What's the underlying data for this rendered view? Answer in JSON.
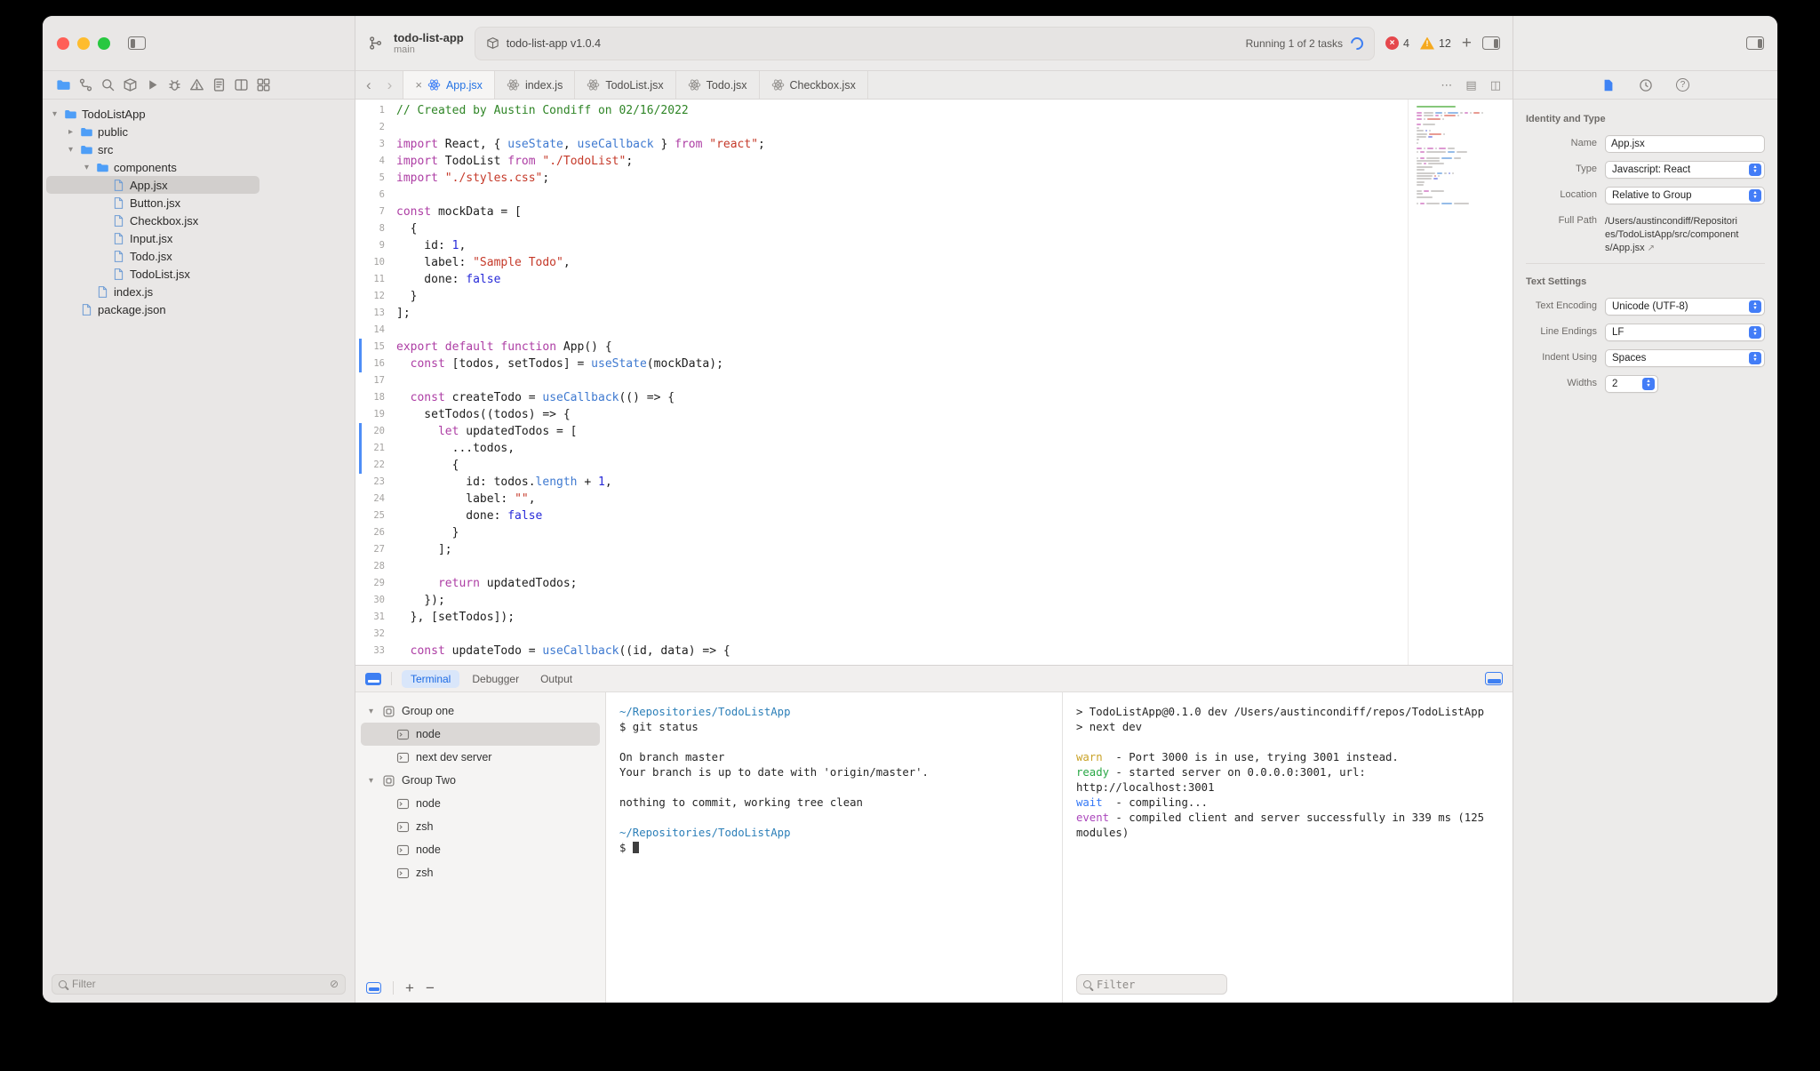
{
  "icons": {
    "back": "‹",
    "forward": "›",
    "close": "×",
    "ellipsis": "⋯",
    "chevron_down": "▾",
    "chevron_right": "▸",
    "plus": "+",
    "minus": "−",
    "filter_clear": "⊘",
    "path_arrow": "↗",
    "warning_mark": "!",
    "error_mark": "×",
    "split_editor": "◫",
    "snippets": "▤",
    "help_mark": "?",
    "stepper_up": "▲",
    "stepper_down": "▼"
  },
  "window": {
    "project": "todo-list-app",
    "branch": "main"
  },
  "toolbar": {
    "scheme_label": "todo-list-app v1.0.4",
    "status_label": "Running 1 of 2 tasks",
    "error_count": "4",
    "warning_count": "12"
  },
  "sidebar": {
    "nav_icons": [
      "project-navigator",
      "source-control",
      "find",
      "packages",
      "run-tasks",
      "debug",
      "issues",
      "reports",
      "editors",
      "overview"
    ],
    "filter_placeholder": "Filter",
    "tree": [
      {
        "label": "TodoListApp",
        "depth": 0,
        "type": "folder",
        "expanded": true
      },
      {
        "label": "public",
        "depth": 1,
        "type": "folder",
        "expanded": false
      },
      {
        "label": "src",
        "depth": 1,
        "type": "folder",
        "expanded": true
      },
      {
        "label": "components",
        "depth": 2,
        "type": "folder",
        "expanded": true
      },
      {
        "label": "App.jsx",
        "depth": 3,
        "type": "file",
        "selected": true
      },
      {
        "label": "Button.jsx",
        "depth": 3,
        "type": "file"
      },
      {
        "label": "Checkbox.jsx",
        "depth": 3,
        "type": "file"
      },
      {
        "label": "Input.jsx",
        "depth": 3,
        "type": "file"
      },
      {
        "label": "Todo.jsx",
        "depth": 3,
        "type": "file"
      },
      {
        "label": "TodoList.jsx",
        "depth": 3,
        "type": "file"
      },
      {
        "label": "index.js",
        "depth": 2,
        "type": "file"
      },
      {
        "label": "package.json",
        "depth": 1,
        "type": "file"
      }
    ]
  },
  "tabs": [
    {
      "label": "App.jsx",
      "active": true
    },
    {
      "label": "index.js"
    },
    {
      "label": "TodoList.jsx"
    },
    {
      "label": "Todo.jsx"
    },
    {
      "label": "Checkbox.jsx"
    }
  ],
  "editor": {
    "changed": [
      15,
      16,
      20,
      21,
      22
    ],
    "lines": [
      [
        [
          "// Created by Austin Condiff on 02/16/2022",
          "cm"
        ]
      ],
      [],
      [
        [
          "import",
          "kw"
        ],
        [
          " React, { ",
          ""
        ],
        [
          "useState",
          "fn"
        ],
        [
          ", ",
          ""
        ],
        [
          "useCallback",
          "fn"
        ],
        [
          " } ",
          ""
        ],
        [
          "from",
          "kw"
        ],
        [
          " ",
          ""
        ],
        [
          "\"react\"",
          "str"
        ],
        [
          ";",
          ""
        ]
      ],
      [
        [
          "import",
          "kw"
        ],
        [
          " TodoList ",
          ""
        ],
        [
          "from",
          "kw"
        ],
        [
          " ",
          ""
        ],
        [
          "\"./TodoList\"",
          "str"
        ],
        [
          ";",
          ""
        ]
      ],
      [
        [
          "import",
          "kw"
        ],
        [
          " ",
          ""
        ],
        [
          "\"./styles.css\"",
          "str"
        ],
        [
          ";",
          ""
        ]
      ],
      [],
      [
        [
          "const",
          "kw"
        ],
        [
          " mockData = [",
          ""
        ]
      ],
      [
        [
          "  {",
          ""
        ]
      ],
      [
        [
          "    id: ",
          ""
        ],
        [
          "1",
          "num"
        ],
        [
          ",",
          ""
        ]
      ],
      [
        [
          "    label: ",
          ""
        ],
        [
          "\"Sample Todo\"",
          "str"
        ],
        [
          ",",
          ""
        ]
      ],
      [
        [
          "    done: ",
          ""
        ],
        [
          "false",
          "num"
        ]
      ],
      [
        [
          "  }",
          ""
        ]
      ],
      [
        [
          "];",
          ""
        ]
      ],
      [],
      [
        [
          "export",
          "kw"
        ],
        [
          " ",
          ""
        ],
        [
          "default",
          "kw"
        ],
        [
          " ",
          ""
        ],
        [
          "function",
          "kw"
        ],
        [
          " App() {",
          ""
        ]
      ],
      [
        [
          "  ",
          ""
        ],
        [
          "const",
          "kw"
        ],
        [
          " [todos, setTodos] = ",
          ""
        ],
        [
          "useState",
          "fn"
        ],
        [
          "(mockData);",
          ""
        ]
      ],
      [],
      [
        [
          "  ",
          ""
        ],
        [
          "const",
          "kw"
        ],
        [
          " createTodo = ",
          ""
        ],
        [
          "useCallback",
          "fn"
        ],
        [
          "(() => {",
          ""
        ]
      ],
      [
        [
          "    setTodos((todos) => {",
          ""
        ]
      ],
      [
        [
          "      ",
          ""
        ],
        [
          "let",
          "kw"
        ],
        [
          " updatedTodos = [",
          ""
        ]
      ],
      [
        [
          "        ...todos,",
          ""
        ]
      ],
      [
        [
          "        {",
          ""
        ]
      ],
      [
        [
          "          id: todos.",
          ""
        ],
        [
          "length",
          "fn"
        ],
        [
          " + ",
          ""
        ],
        [
          "1",
          "num"
        ],
        [
          ",",
          ""
        ]
      ],
      [
        [
          "          label: ",
          ""
        ],
        [
          "\"\"",
          "str"
        ],
        [
          ",",
          ""
        ]
      ],
      [
        [
          "          done: ",
          ""
        ],
        [
          "false",
          "num"
        ]
      ],
      [
        [
          "        }",
          ""
        ]
      ],
      [
        [
          "      ];",
          ""
        ]
      ],
      [],
      [
        [
          "      ",
          ""
        ],
        [
          "return",
          "kw"
        ],
        [
          " updatedTodos;",
          ""
        ]
      ],
      [
        [
          "    });",
          ""
        ]
      ],
      [
        [
          "  }, [setTodos]);",
          ""
        ]
      ],
      [],
      [
        [
          "  ",
          ""
        ],
        [
          "const",
          "kw"
        ],
        [
          " updateTodo = ",
          ""
        ],
        [
          "useCallback",
          "fn"
        ],
        [
          "((id, data) => {",
          ""
        ]
      ]
    ]
  },
  "inspector": {
    "icon_names": [
      "file-inspector",
      "history-inspector",
      "quick-help-inspector"
    ],
    "identity_title": "Identity and Type",
    "fields": {
      "name": {
        "label": "Name",
        "value": "App.jsx"
      },
      "type": {
        "label": "Type",
        "value": "Javascript: React"
      },
      "location": {
        "label": "Location",
        "value": "Relative to Group"
      },
      "full_path": {
        "label": "Full Path",
        "value": "/Users/austincondiff/Repositories/TodoListApp/src/components/App.jsx"
      }
    },
    "text_settings_title": "Text Settings",
    "settings": {
      "encoding": {
        "label": "Text Encoding",
        "value": "Unicode (UTF-8)"
      },
      "line_endings": {
        "label": "Line Endings",
        "value": "LF"
      },
      "indent": {
        "label": "Indent Using",
        "value": "Spaces"
      },
      "widths": {
        "label": "Widths",
        "value": "2"
      }
    }
  },
  "panel": {
    "tabs": [
      {
        "label": "Terminal",
        "active": true
      },
      {
        "label": "Debugger"
      },
      {
        "label": "Output"
      }
    ],
    "filter_placeholder": "Filter",
    "groups": [
      {
        "label": "Group one",
        "type": "group",
        "depth": 0,
        "expanded": true
      },
      {
        "label": "node",
        "type": "terminal",
        "depth": 1,
        "selected": true
      },
      {
        "label": "next dev server",
        "type": "terminal",
        "depth": 1
      },
      {
        "label": "Group Two",
        "type": "group",
        "depth": 0,
        "expanded": true
      },
      {
        "label": "node",
        "type": "terminal",
        "depth": 1
      },
      {
        "label": "zsh",
        "type": "terminal",
        "depth": 1
      },
      {
        "label": "node",
        "type": "terminal",
        "depth": 1
      },
      {
        "label": "zsh",
        "type": "terminal",
        "depth": 1
      }
    ],
    "terminal_left": [
      {
        "s": [
          [
            "~/Repositories/TodoListApp",
            "path"
          ]
        ]
      },
      {
        "s": [
          [
            "$ git status",
            ""
          ]
        ]
      },
      {
        "s": []
      },
      {
        "s": [
          [
            "On branch master",
            ""
          ]
        ]
      },
      {
        "s": [
          [
            "Your branch is up to date with 'origin/master'.",
            ""
          ]
        ]
      },
      {
        "s": []
      },
      {
        "s": [
          [
            "nothing to commit, working tree clean",
            ""
          ]
        ]
      },
      {
        "s": []
      },
      {
        "s": [
          [
            "~/Repositories/TodoListApp",
            "path"
          ]
        ]
      },
      {
        "s": [
          [
            "$ ",
            ""
          ]
        ],
        "cursor": true
      }
    ],
    "terminal_right": [
      {
        "s": [
          [
            "> TodoListApp@0.1.0 dev /Users/austincondiff/repos/TodoListApp",
            ""
          ]
        ]
      },
      {
        "s": [
          [
            "> next dev",
            ""
          ]
        ]
      },
      {
        "s": []
      },
      {
        "s": [
          [
            "warn",
            "warn"
          ],
          [
            "  - Port 3000 is in use, trying 3001 instead.",
            ""
          ]
        ]
      },
      {
        "s": [
          [
            "ready",
            "ready"
          ],
          [
            " - started server on 0.0.0.0:3001, url: http://localhost:3001",
            ""
          ]
        ]
      },
      {
        "s": [
          [
            "wait",
            "wait"
          ],
          [
            "  - compiling...",
            ""
          ]
        ]
      },
      {
        "s": [
          [
            "event",
            "event"
          ],
          [
            " - compiled client and server successfully in 339 ms (125 modules)",
            ""
          ]
        ]
      }
    ]
  }
}
